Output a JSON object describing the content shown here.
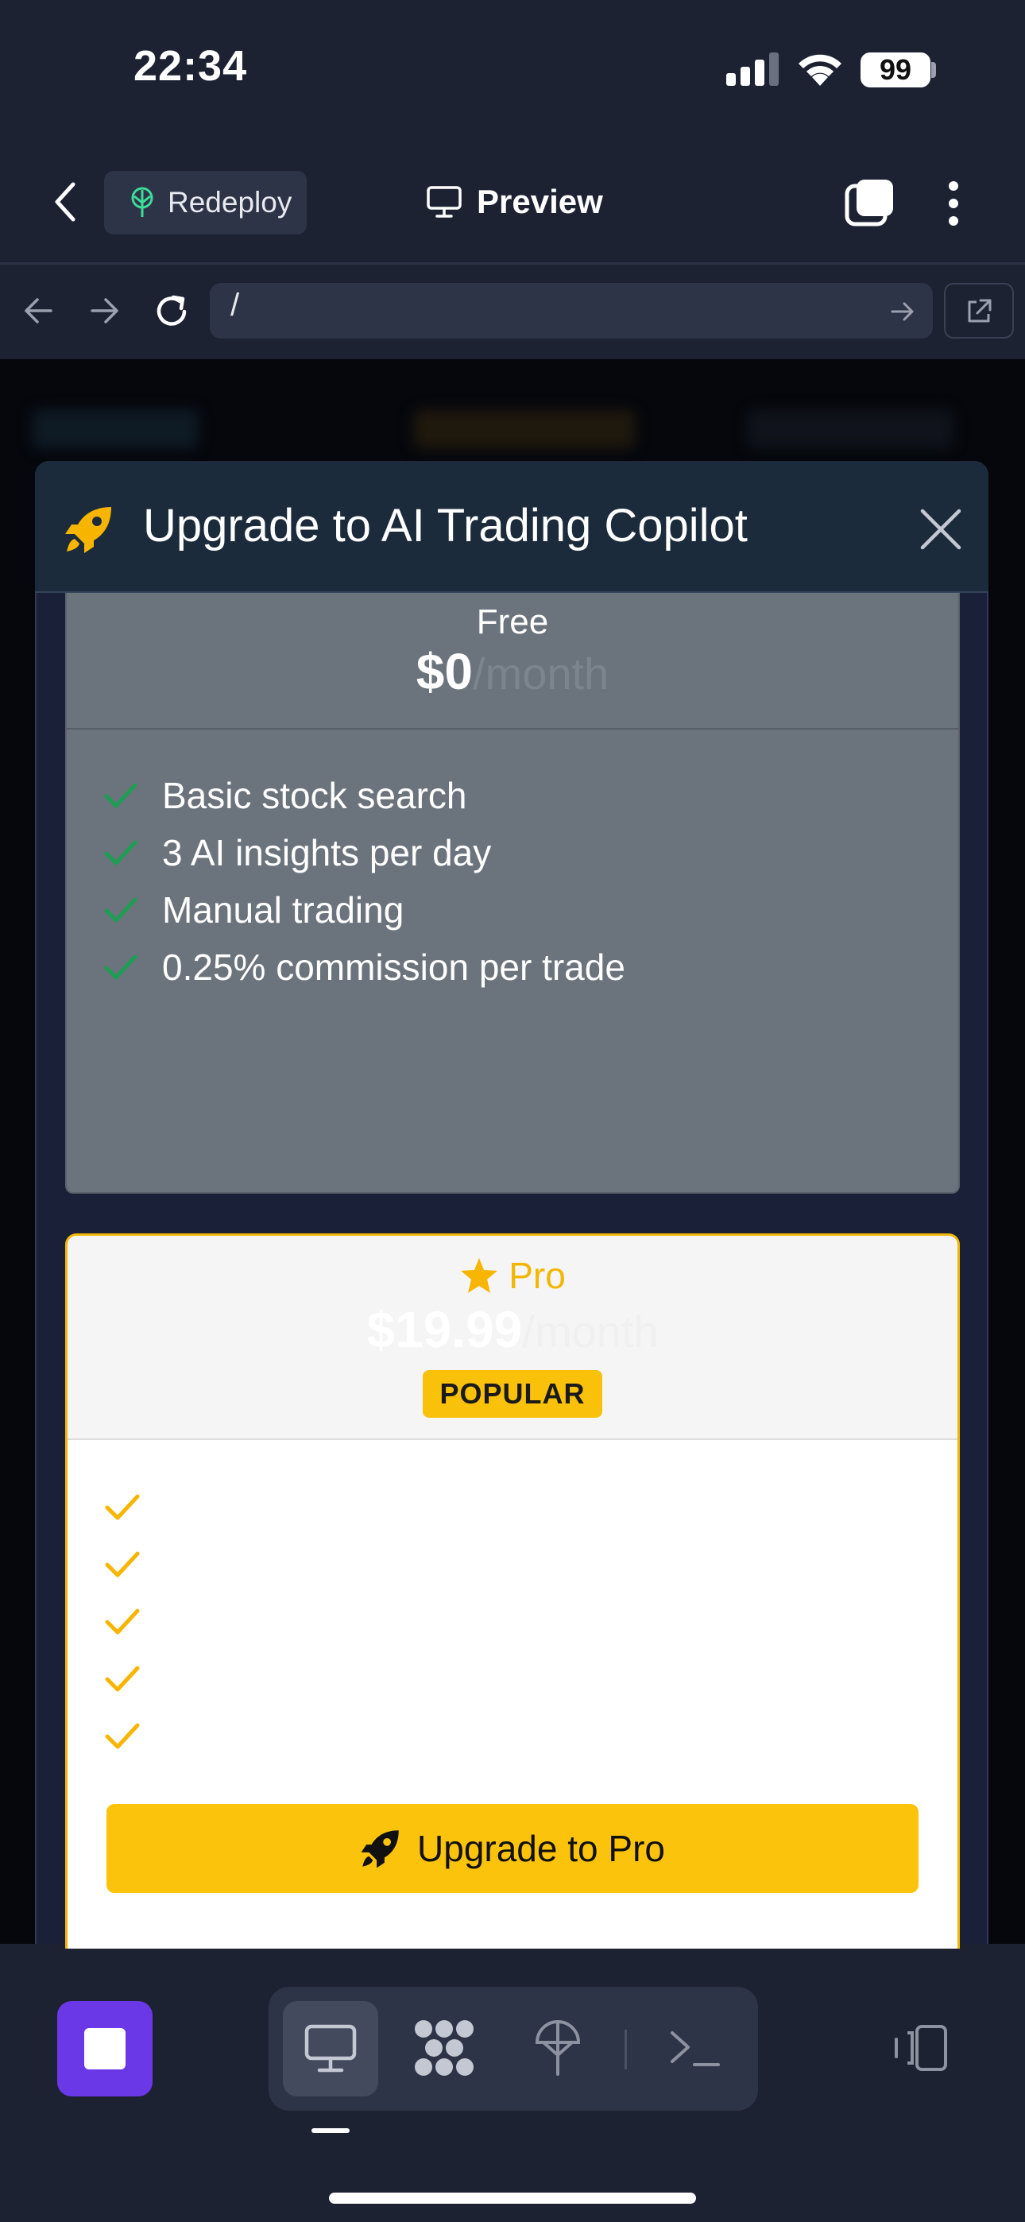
{
  "status_bar": {
    "time": "22:34",
    "battery": "99",
    "icons": [
      "signal-icon",
      "wifi-icon",
      "battery-icon"
    ]
  },
  "top_bar": {
    "back_icon": "chevron-left-icon",
    "redeploy_label": "Redeploy",
    "redeploy_icon": "deploy-tree-icon",
    "title": "Preview",
    "title_icon": "monitor-icon",
    "tabs_icon": "tabs-icon",
    "menu_icon": "more-vertical-icon"
  },
  "address_bar": {
    "url": "/",
    "icons": [
      "arrow-left-icon",
      "arrow-right-icon",
      "reload-icon",
      "go-arrow-icon",
      "external-link-icon"
    ]
  },
  "modal": {
    "title": "Upgrade to AI Trading Copilot",
    "title_icon": "rocket-icon",
    "close_icon": "close-icon",
    "plans": {
      "free": {
        "name": "Free",
        "price": "$0",
        "period": "/month",
        "features": [
          "Basic stock search",
          "3 AI insights per day",
          "Manual trading",
          "0.25% commission per trade"
        ]
      },
      "pro": {
        "name": "Pro",
        "name_icon": "star-icon",
        "price": "$19.99",
        "period": "/month",
        "badge": "POPULAR",
        "feature_count_visible_checks": 5,
        "cta_label": "Upgrade to Pro",
        "cta_icon": "rocket-icon"
      }
    }
  },
  "bottom_toolbar": {
    "icons": [
      "stop-icon",
      "monitor-icon",
      "nodes-icon",
      "deploy-tree-icon",
      "terminal-icon",
      "devices-icon"
    ]
  },
  "colors": {
    "background": "#1d2233",
    "accent_yellow": "#fbc30b",
    "check_green": "#1f9d55",
    "stop_purple": "#6b38e8"
  }
}
